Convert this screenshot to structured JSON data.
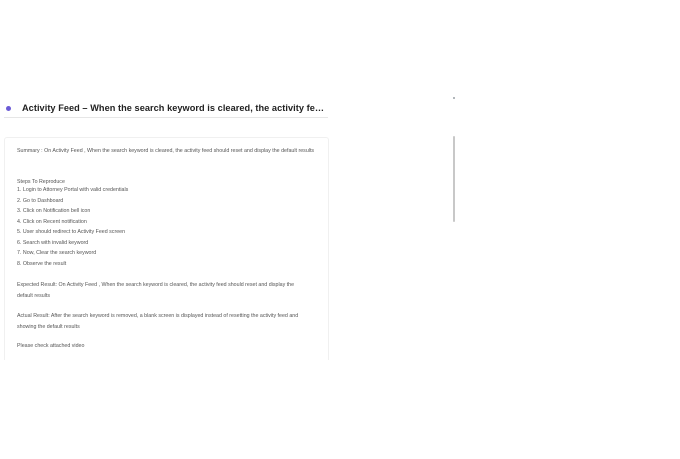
{
  "title": "Activity Feed – When the search keyword is cleared, the activity feed s...",
  "summary": "Summary : On Activity Feed , When the search keyword is cleared, the activity feed should reset and display the default results",
  "steps_title": "Steps To Reproduce",
  "steps": [
    "1.  Login to Attorney Portal with valid credentials",
    "2.  Go to Dashboard",
    "3.  Click on Notification bell icon",
    "4.  Click on Recent notification",
    "5.  User should redirect to Activity Feed screen",
    "6.  Search with invalid keyword",
    "7.  Now, Clear the search keyword",
    "8.  Observe the result"
  ],
  "expected": "Expected Result: On Activity Feed , When the search keyword is cleared, the activity feed should reset and display the default results",
  "actual": "Actual Result: After the search keyword is removed, a blank screen is displayed instead of resetting the activity feed and showing the default results",
  "note": "Please check attached video"
}
